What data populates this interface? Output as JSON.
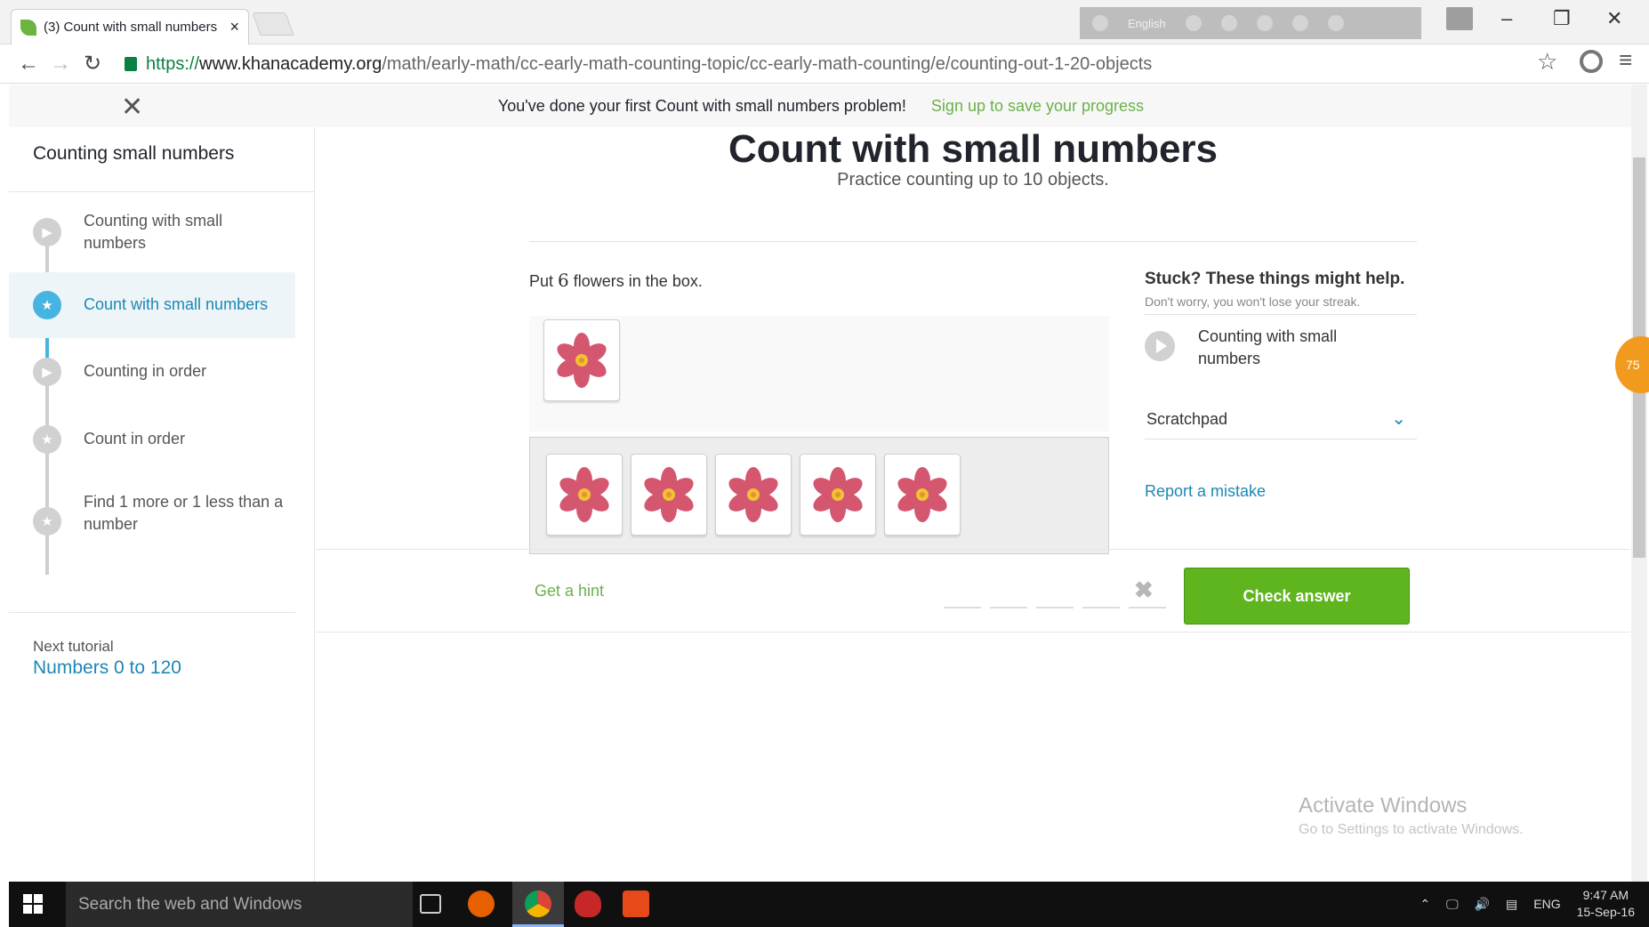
{
  "browser": {
    "tab_title": "(3) Count with small numbers",
    "tab_close": "×",
    "ext_lang": "English",
    "url_https": "https://",
    "url_host": "www.khanacademy.org",
    "url_path": "/math/early-math/cc-early-math-counting-topic/cc-early-math-counting/e/counting-out-1-20-objects"
  },
  "notification": {
    "message": "You've done your first Count with small numbers problem!",
    "signup": "Sign up to save your progress"
  },
  "sidebar": {
    "title": "Counting small numbers",
    "items": [
      {
        "label": "Counting with small numbers",
        "icon": "play-icon"
      },
      {
        "label": "Count with small numbers",
        "icon": "star-icon"
      },
      {
        "label": "Counting in order",
        "icon": "play-icon"
      },
      {
        "label": "Count in order",
        "icon": "star-icon"
      },
      {
        "label": "Find 1 more or 1 less than a number",
        "icon": "star-icon"
      }
    ],
    "next_label": "Next tutorial",
    "next_link": "Numbers 0 to 120"
  },
  "exercise": {
    "title": "Count with small numbers",
    "subtitle": "Practice counting up to 10 objects.",
    "prompt_pre": "Put ",
    "prompt_num": "6",
    "prompt_post": " flowers in the box.",
    "flowers_in_box": 1,
    "flowers_in_bank": 5
  },
  "help": {
    "title": "Stuck? These things might help.",
    "subtitle": "Don't worry, you won't lose your streak.",
    "video": "Counting with small numbers",
    "scratchpad": "Scratchpad",
    "report": "Report a mistake"
  },
  "actions": {
    "hint": "Get a hint",
    "check": "Check answer"
  },
  "watermark": {
    "line1": "Activate Windows",
    "line2": "Go to Settings to activate Windows."
  },
  "badge": "75",
  "taskbar": {
    "search": "Search the web and Windows",
    "lang": "ENG",
    "time": "9:47 AM",
    "date": "15-Sep-16"
  },
  "colors": {
    "accent_blue": "#1c88b5",
    "accent_green": "#6bb14b",
    "check_green": "#5fb51d",
    "flower": "#d4576f"
  }
}
